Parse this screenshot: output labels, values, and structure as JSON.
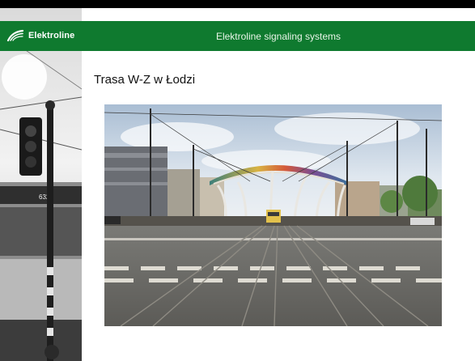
{
  "header": {
    "brand_name": "Elektroline",
    "brand_icon": "elektroline-logo-icon",
    "title": "Elektroline signaling systems",
    "band_color": "#0f7a2f"
  },
  "slide": {
    "title": "Trasa W-Z w Łodzi"
  },
  "side_image": {
    "bus_number": "632"
  }
}
